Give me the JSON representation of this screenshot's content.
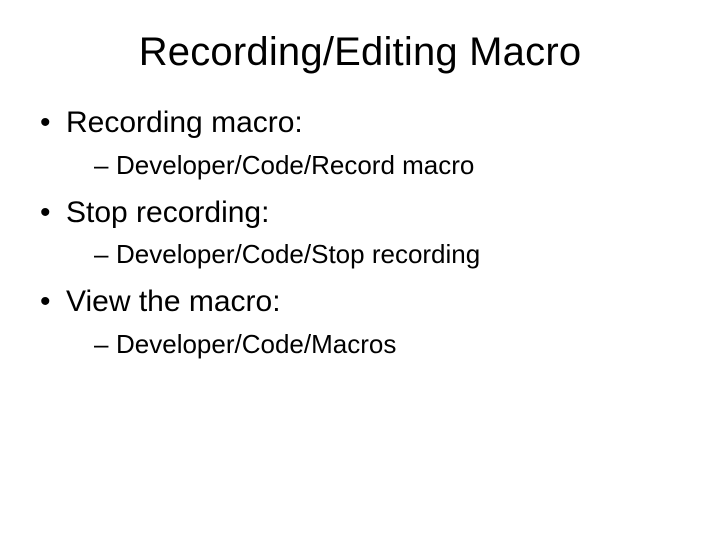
{
  "title": "Recording/Editing Macro",
  "bullets": [
    {
      "label": "Recording macro:",
      "sub": [
        "Developer/Code/Record macro"
      ]
    },
    {
      "label": "Stop recording:",
      "sub": [
        "Developer/Code/Stop recording"
      ]
    },
    {
      "label": "View the macro:",
      "sub": [
        "Developer/Code/Macros"
      ]
    }
  ]
}
